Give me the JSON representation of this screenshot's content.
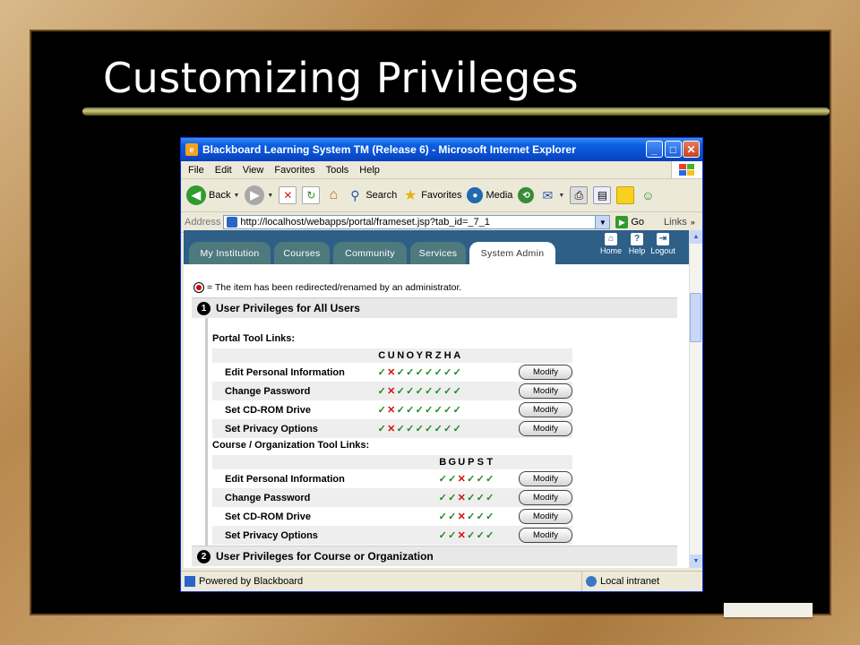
{
  "slide": {
    "title": "Customizing Privileges"
  },
  "browser": {
    "title": "Blackboard Learning System TM (Release 6) - Microsoft Internet Explorer",
    "menu": [
      "File",
      "Edit",
      "View",
      "Favorites",
      "Tools",
      "Help"
    ],
    "toolbar": {
      "back": "Back",
      "search": "Search",
      "favorites": "Favorites",
      "media": "Media"
    },
    "address": {
      "label": "Address",
      "url": "http://localhost/webapps/portal/frameset.jsp?tab_id=_7_1",
      "go": "Go",
      "links": "Links"
    },
    "status": {
      "text": "Powered by Blackboard",
      "zone": "Local intranet"
    }
  },
  "page": {
    "tabs": [
      "My Institution",
      "Courses",
      "Community",
      "Services",
      "System Admin"
    ],
    "active_tab": "System Admin",
    "header_links": [
      "Home",
      "Help",
      "Logout"
    ],
    "legend": "= The item has been redirected/renamed by an administrator.",
    "section1": {
      "number": "1",
      "title": "User Privileges for All Users"
    },
    "section2": {
      "number": "2",
      "title": "User Privileges for Course or Organization"
    },
    "modify_label": "Modify",
    "portal": {
      "heading": "Portal Tool Links:",
      "columns": [
        "C",
        "U",
        "N",
        "O",
        "Y",
        "R",
        "Z",
        "H",
        "A"
      ],
      "rows": [
        {
          "label": "Edit Personal Information",
          "marks": [
            "y",
            "n",
            "y",
            "y",
            "y",
            "y",
            "y",
            "y",
            "y"
          ]
        },
        {
          "label": "Change Password",
          "marks": [
            "y",
            "n",
            "y",
            "y",
            "y",
            "y",
            "y",
            "y",
            "y"
          ]
        },
        {
          "label": "Set CD-ROM Drive",
          "marks": [
            "y",
            "n",
            "y",
            "y",
            "y",
            "y",
            "y",
            "y",
            "y"
          ]
        },
        {
          "label": "Set Privacy Options",
          "marks": [
            "y",
            "n",
            "y",
            "y",
            "y",
            "y",
            "y",
            "y",
            "y"
          ]
        }
      ]
    },
    "course": {
      "heading": "Course / Organization Tool Links:",
      "columns": [
        "B",
        "G",
        "U",
        "P",
        "S",
        "T"
      ],
      "rows": [
        {
          "label": "Edit Personal Information",
          "marks": [
            "y",
            "y",
            "n",
            "y",
            "y",
            "y"
          ]
        },
        {
          "label": "Change Password",
          "marks": [
            "y",
            "y",
            "n",
            "y",
            "y",
            "y"
          ]
        },
        {
          "label": "Set CD-ROM Drive",
          "marks": [
            "y",
            "y",
            "n",
            "y",
            "y",
            "y"
          ]
        },
        {
          "label": "Set Privacy Options",
          "marks": [
            "y",
            "y",
            "n",
            "y",
            "y",
            "y"
          ]
        }
      ]
    }
  },
  "icons": {
    "check": "✓",
    "cross": "✕"
  },
  "colors": {
    "check": "#1d8a1d",
    "cross": "#d01010",
    "nav_band": "#2d5f87",
    "titlebar": "#0a4fd0"
  }
}
